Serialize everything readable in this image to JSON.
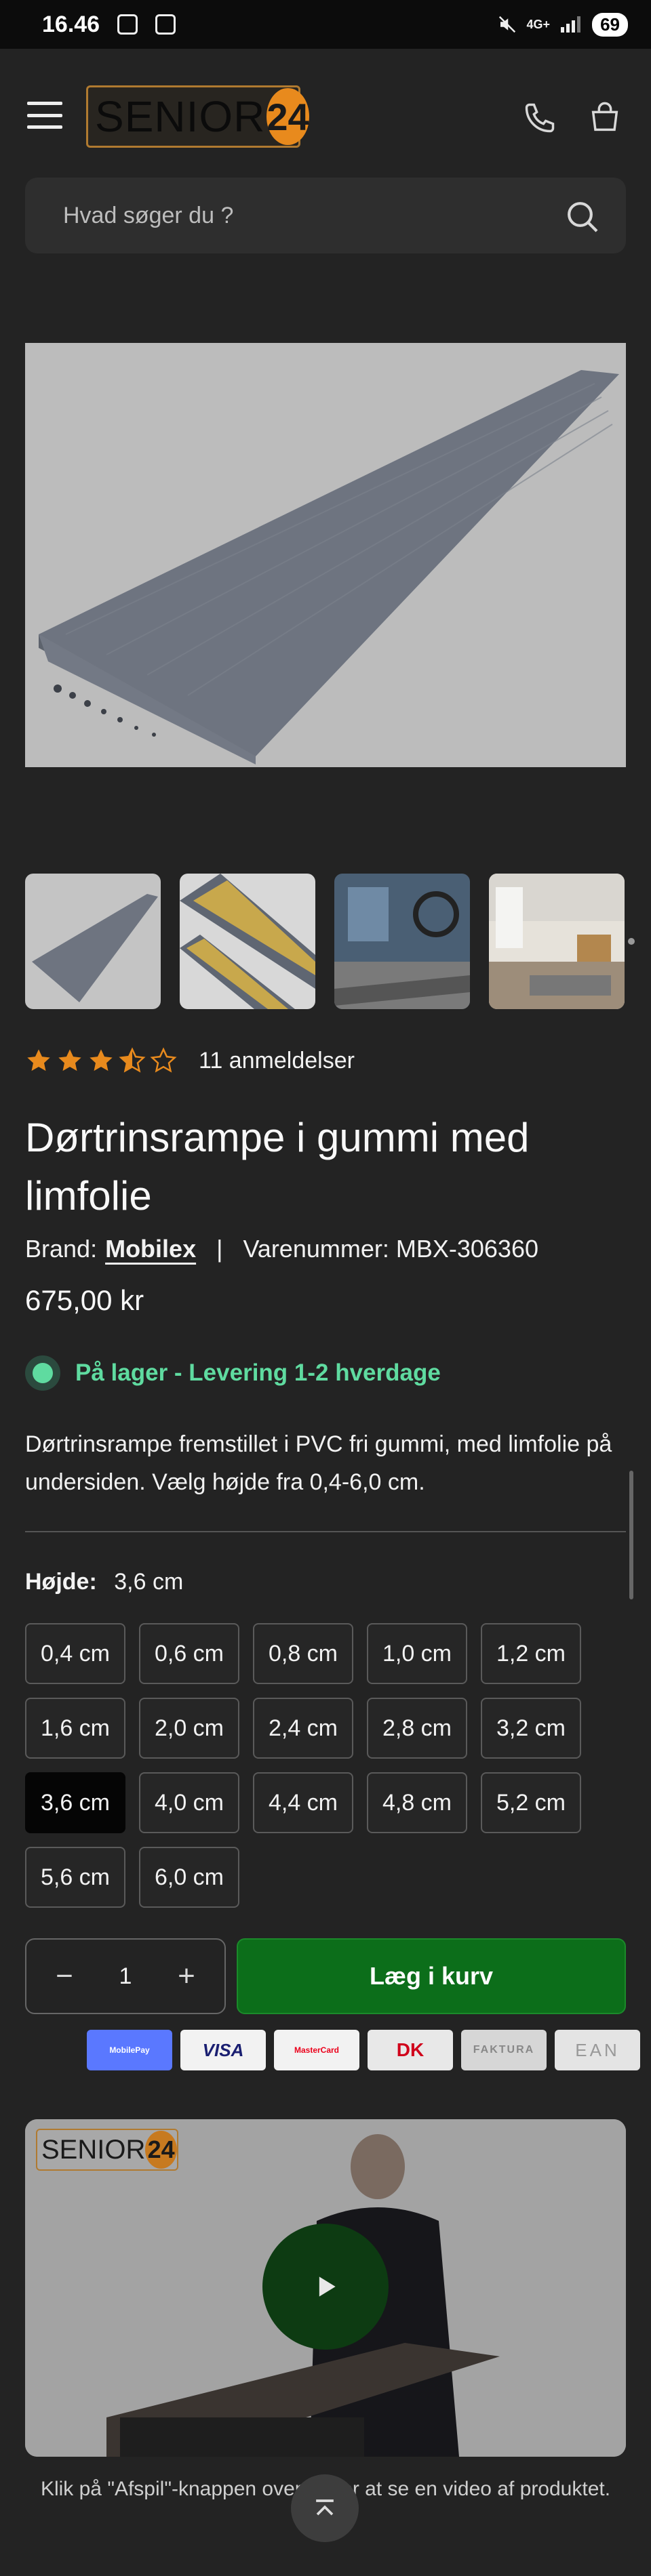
{
  "status_bar": {
    "time": "16.46",
    "network": "4G+",
    "battery": "69"
  },
  "header": {
    "logo_text": "SENIOR",
    "logo_number": "24"
  },
  "search": {
    "placeholder": "Hvad søger du ?"
  },
  "product": {
    "rating": 3.5,
    "rating_max": 5,
    "reviews_label": "11 anmeldelser",
    "title": "Dørtrinsrampe i gummi med limfolie",
    "brand_label": "Brand:",
    "brand_name": "Mobilex",
    "sku_label": "Varenummer: MBX-306360",
    "price": "675,00 kr",
    "stock": "På lager - Levering 1-2 hverdage",
    "description": "Dørtrinsrampe fremstillet i PVC fri gummi, med limfolie på undersiden. Vælg højde fra 0,4-6,0 cm.",
    "variant_label": "Højde:",
    "variant_selected": "3,6 cm",
    "options": [
      "0,4 cm",
      "0,6 cm",
      "0,8 cm",
      "1,0 cm",
      "1,2 cm",
      "1,6 cm",
      "2,0 cm",
      "2,4 cm",
      "2,8 cm",
      "3,2 cm",
      "3,6 cm",
      "4,0 cm",
      "4,4 cm",
      "4,8 cm",
      "5,2 cm",
      "5,6 cm",
      "6,0 cm"
    ],
    "quantity": "1",
    "add_to_cart": "Læg i kurv"
  },
  "payments": [
    {
      "label": "MobilePay",
      "bg": "#5a78ff",
      "fg": "#ffffff"
    },
    {
      "label": "VISA",
      "bg": "#f2f2f2",
      "fg": "#1a1f71"
    },
    {
      "label": "MasterCard",
      "bg": "#f2f2f2",
      "fg": "#eb001b"
    },
    {
      "label": "DK",
      "bg": "#e8e8e8",
      "fg": "#d0021b"
    },
    {
      "label": "FAKTURA",
      "bg": "#d6d6d6",
      "fg": "#888888"
    },
    {
      "label": "EAN",
      "bg": "#e4e4e4",
      "fg": "#999999"
    }
  ],
  "video": {
    "logo_text": "SENIOR",
    "logo_number": "24",
    "caption": "Klik på \"Afspil\"-knappen ovenfor for at se en video af produktet."
  },
  "colors": {
    "accent_green": "#0c6e1a",
    "stock_green": "#5fdba0",
    "star": "#e88a1d"
  }
}
